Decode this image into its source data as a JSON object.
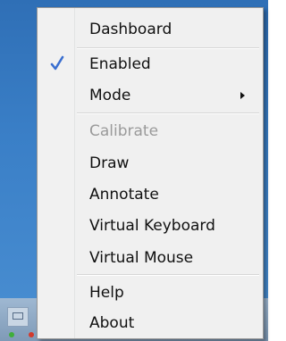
{
  "menu": {
    "items": [
      {
        "label": "Dashboard"
      },
      {
        "label": "Enabled",
        "checked": true
      },
      {
        "label": "Mode",
        "has_submenu": true
      },
      {
        "label": "Calibrate",
        "disabled": true
      },
      {
        "label": "Draw"
      },
      {
        "label": "Annotate"
      },
      {
        "label": "Virtual Keyboard"
      },
      {
        "label": "Virtual Mouse"
      },
      {
        "label": "Help"
      },
      {
        "label": "About"
      }
    ]
  },
  "colors": {
    "menu_background": "#f0f0f0",
    "checkmark": "#3a6fd0",
    "disabled_text": "#9a9a9a",
    "desktop": "#3a7fc7"
  }
}
